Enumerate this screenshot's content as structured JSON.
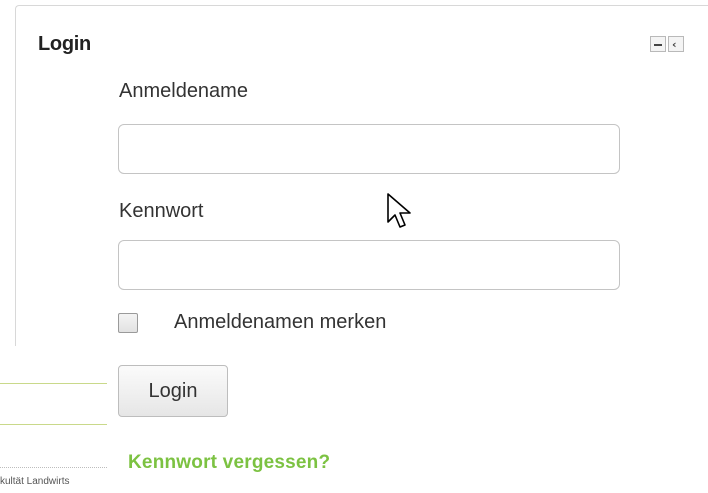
{
  "block": {
    "title": "Login",
    "controls": [
      {
        "name": "collapse",
        "icon": "minus-icon"
      },
      {
        "name": "dock",
        "icon": "chevron-left-icon",
        "glyph": "‹"
      }
    ]
  },
  "form": {
    "username_label": "Anmeldename",
    "username_value": "",
    "password_label": "Kennwort",
    "password_value": "",
    "remember_label": "Anmeldenamen merken",
    "remember_checked": false,
    "login_button": "Login",
    "forgot_link": "Kennwort vergessen?"
  },
  "background": {
    "footer_text": "kultät Landwirts"
  },
  "colors": {
    "link": "#7cc242",
    "accent_line": "#c9d98a"
  }
}
